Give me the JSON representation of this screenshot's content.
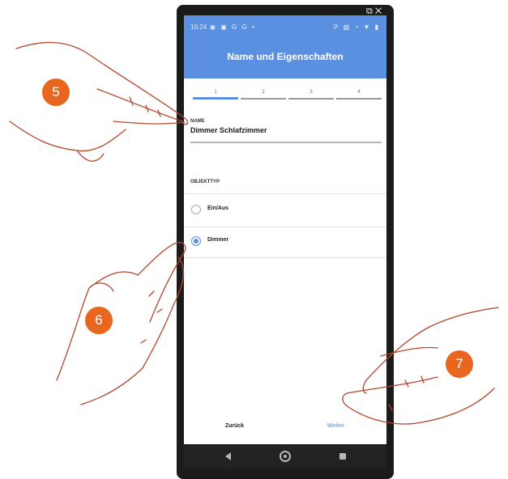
{
  "window": {
    "controls": [
      "external-link-icon",
      "close-icon"
    ]
  },
  "status_bar": {
    "time": "10:24",
    "left_icons": [
      "eye-icon",
      "storage-icon",
      "g-icon",
      "g-icon",
      "dot-icon"
    ],
    "right_icons": [
      "bluetooth-icon",
      "vibrate-icon",
      "alarm-icon",
      "wifi-icon",
      "battery-icon"
    ]
  },
  "header": {
    "title": "Name und Eigenschaften"
  },
  "stepper": {
    "steps": [
      "1",
      "2",
      "3",
      "4"
    ],
    "active_step": 1
  },
  "name_field": {
    "label": "NAME",
    "value": "Dimmer Schlafzimmer"
  },
  "object_type": {
    "label": "OBJEKTTYP",
    "options": [
      {
        "label": "Ein/Aus",
        "selected": false
      },
      {
        "label": "Dimmer",
        "selected": true
      }
    ]
  },
  "footer": {
    "back_label": "Zurück",
    "next_label": "Weiter"
  },
  "nav_bar": {
    "buttons": [
      "back-icon",
      "home-icon",
      "recents-icon"
    ]
  },
  "annotations": {
    "badges": [
      "5",
      "6",
      "7"
    ],
    "badge_color": "#e8661e"
  },
  "colors": {
    "accent": "#5b8fe0",
    "next_button": "#7fa8ec"
  }
}
